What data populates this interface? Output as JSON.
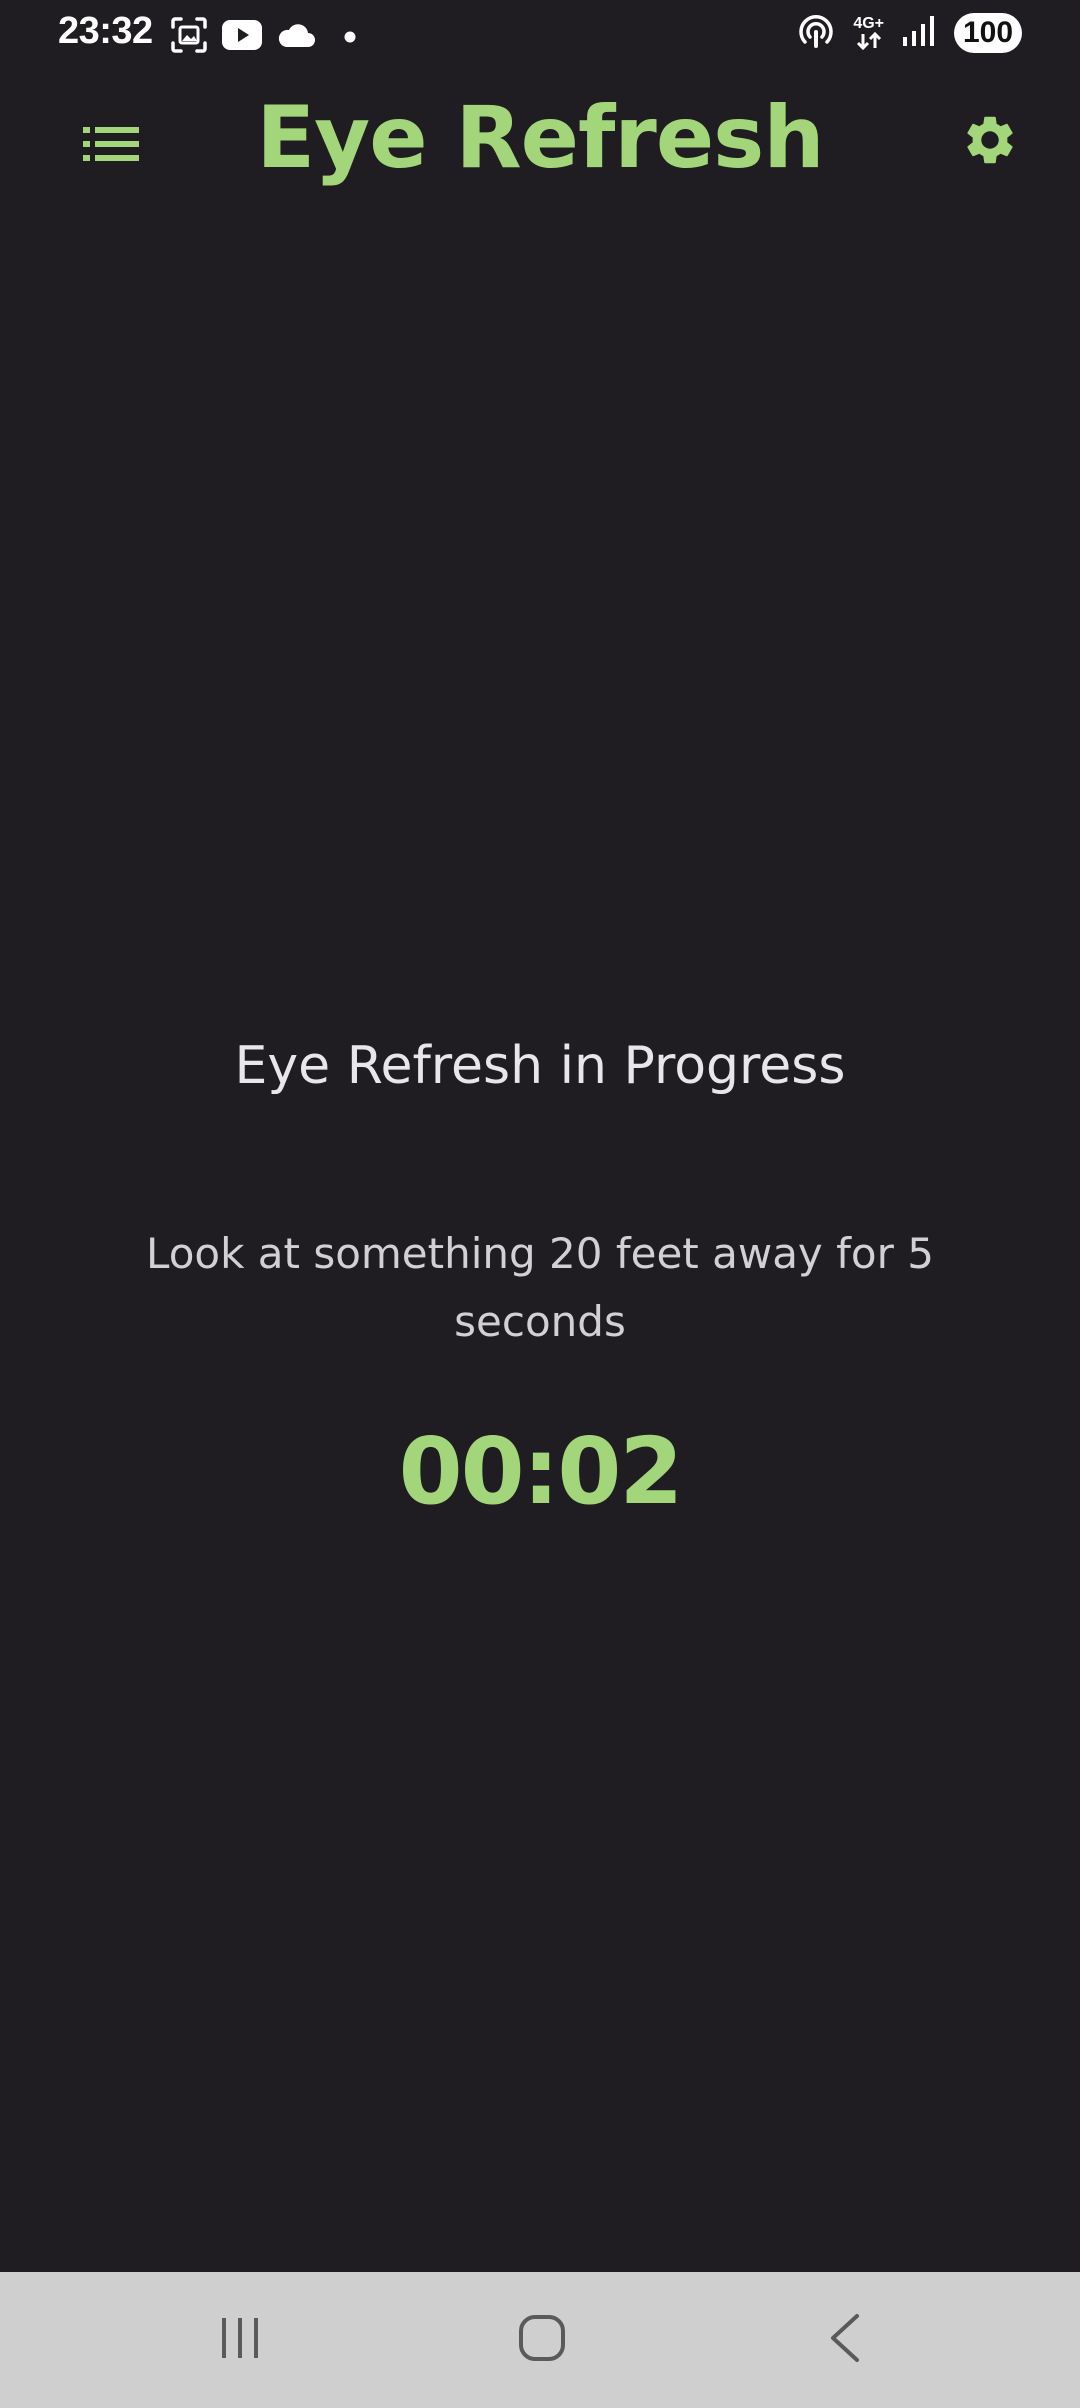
{
  "status_bar": {
    "time": "23:32",
    "battery": "100",
    "network": "4G+",
    "icons": [
      "screenshot-icon",
      "youtube-icon",
      "cloud-icon",
      "dot-icon",
      "hotspot-icon",
      "network-arrows-icon",
      "signal-icon",
      "battery-icon"
    ]
  },
  "app_bar": {
    "title": "Eye Refresh",
    "menu_icon": "list-icon",
    "settings_icon": "gear-icon"
  },
  "main": {
    "heading": "Eye Refresh in Progress",
    "instruction": "Look at something 20 feet away for 5 seconds",
    "timer": "00:02"
  },
  "nav_bar": {
    "buttons": [
      "recents-icon",
      "home-icon",
      "back-icon"
    ]
  },
  "colors": {
    "background": "#1f1d21",
    "accent": "#a3d67a",
    "text": "#e8e6ea",
    "nav_bar": "#cfcfcf"
  }
}
